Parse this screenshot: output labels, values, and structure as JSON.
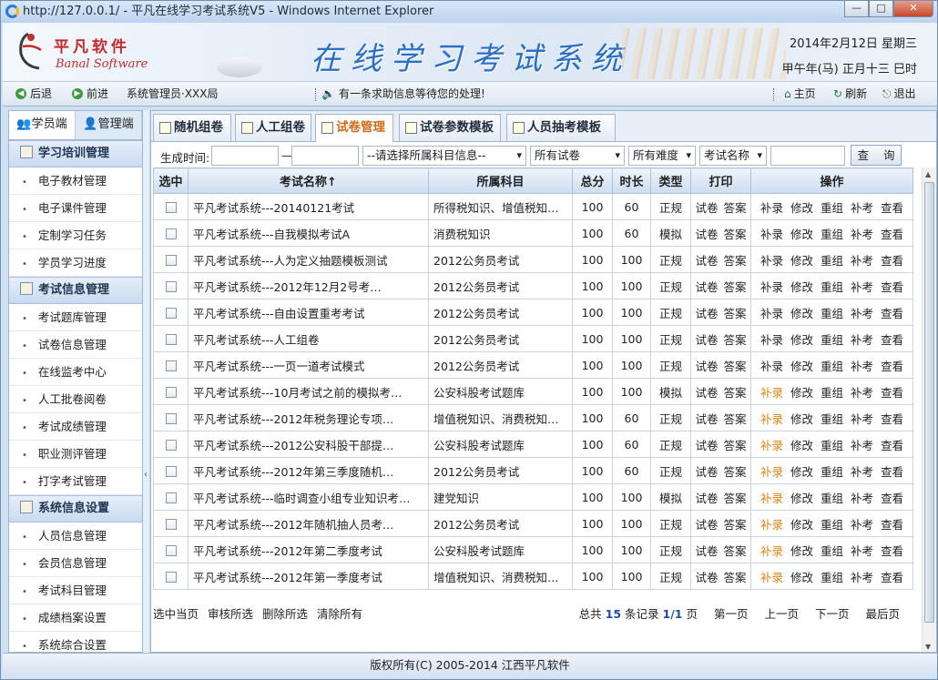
{
  "window": {
    "title": "http://127.0.0.1/ - 平凡在线学习考试系统V5 - Windows Internet Explorer",
    "controls": {
      "minimize": "—",
      "maximize": "□",
      "close": "✕"
    }
  },
  "header": {
    "logo_cn": "平凡软件",
    "logo_en": "Banal Software",
    "system_title": "在线学习考试系统",
    "date": "2014年2月12日 星期三",
    "lunar_date": "甲午年(马) 正月十三 巳时"
  },
  "navbar": {
    "back": "后退",
    "forward": "前进",
    "user": "系统管理员·XXX局",
    "notice": "有一条求助信息等待您的处理!",
    "home": "主页",
    "refresh": "刷新",
    "logout": "退出"
  },
  "sidebar": {
    "tabs": [
      "学员端",
      "管理端"
    ],
    "groups": [
      {
        "title": "学习培训管理",
        "items": [
          "电子教材管理",
          "电子课件管理",
          "定制学习任务",
          "学员学习进度"
        ]
      },
      {
        "title": "考试信息管理",
        "items": [
          "考试题库管理",
          "试卷信息管理",
          "在线监考中心",
          "人工批卷阅卷",
          "考试成绩管理",
          "职业测评管理",
          "打字考试管理"
        ]
      },
      {
        "title": "系统信息设置",
        "items": [
          "人员信息管理",
          "会员信息管理",
          "考试科目管理",
          "成绩档案设置",
          "系统综合设置"
        ]
      }
    ]
  },
  "tabs": [
    "随机组卷",
    "人工组卷",
    "试卷管理",
    "试卷参数模板",
    "人员抽考模板"
  ],
  "filters": {
    "date_label": "生成时间:",
    "date_sep": "—",
    "subject": "--请选择所属科目信息--",
    "paper": "所有试卷",
    "difficulty": "所有难度",
    "field": "考试名称",
    "query": "查 询"
  },
  "table": {
    "headers": [
      "选中",
      "考试名称↑",
      "所属科目",
      "总分",
      "时长",
      "类型",
      "打印",
      "操作"
    ],
    "print_labels": [
      "试卷",
      "答案"
    ],
    "op_labels": [
      "补录",
      "修改",
      "重组",
      "补考",
      "查看"
    ],
    "rows": [
      {
        "name": "平凡考试系统---20140121考试",
        "subject": "所得税知识、增值税知…",
        "score": "100",
        "duration": "60",
        "type": "正规",
        "hl": false
      },
      {
        "name": "平凡考试系统---自我模拟考试A",
        "subject": "消费税知识",
        "score": "100",
        "duration": "60",
        "type": "模拟",
        "hl": false
      },
      {
        "name": "平凡考试系统---人为定义抽题模板测试",
        "subject": "2012公务员考试",
        "score": "100",
        "duration": "100",
        "type": "正规",
        "hl": false
      },
      {
        "name": "平凡考试系统---2012年12月2号考…",
        "subject": "2012公务员考试",
        "score": "100",
        "duration": "100",
        "type": "正规",
        "hl": false
      },
      {
        "name": "平凡考试系统---自由设置重考考试",
        "subject": "2012公务员考试",
        "score": "100",
        "duration": "100",
        "type": "正规",
        "hl": false
      },
      {
        "name": "平凡考试系统---人工组卷",
        "subject": "2012公务员考试",
        "score": "100",
        "duration": "100",
        "type": "正规",
        "hl": false
      },
      {
        "name": "平凡考试系统---一页一道考试模式",
        "subject": "2012公务员考试",
        "score": "100",
        "duration": "100",
        "type": "正规",
        "hl": false
      },
      {
        "name": "平凡考试系统---10月考试之前的模拟考…",
        "subject": "公安科股考试题库",
        "score": "100",
        "duration": "100",
        "type": "模拟",
        "hl": true
      },
      {
        "name": "平凡考试系统---2012年税务理论专项…",
        "subject": "增值税知识、消费税知…",
        "score": "100",
        "duration": "60",
        "type": "正规",
        "hl": true
      },
      {
        "name": "平凡考试系统---2012公安科股干部提…",
        "subject": "公安科股考试题库",
        "score": "100",
        "duration": "60",
        "type": "正规",
        "hl": true
      },
      {
        "name": "平凡考试系统---2012年第三季度随机…",
        "subject": "2012公务员考试",
        "score": "100",
        "duration": "60",
        "type": "正规",
        "hl": true
      },
      {
        "name": "平凡考试系统---临时调查小组专业知识考…",
        "subject": "建党知识",
        "score": "100",
        "duration": "100",
        "type": "模拟",
        "hl": true
      },
      {
        "name": "平凡考试系统---2012年随机抽人员考…",
        "subject": "2012公务员考试",
        "score": "100",
        "duration": "100",
        "type": "正规",
        "hl": true
      },
      {
        "name": "平凡考试系统---2012年第二季度考试",
        "subject": "公安科股考试题库",
        "score": "100",
        "duration": "100",
        "type": "正规",
        "hl": true
      },
      {
        "name": "平凡考试系统---2012年第一季度考试",
        "subject": "增值税知识、消费税知…",
        "score": "100",
        "duration": "100",
        "type": "正规",
        "hl": true
      }
    ]
  },
  "actions": {
    "select_page": "选中当页",
    "approve": "审核所选",
    "delete": "删除所选",
    "clear": "清除所有"
  },
  "pager": {
    "total_prefix": "总共",
    "total": "15",
    "total_suffix": "条记录",
    "page": "1/1",
    "page_suffix": "页",
    "first": "第一页",
    "prev": "上一页",
    "next": "下一页",
    "last": "最后页"
  },
  "copyright": "版权所有(C) 2005-2014 江西平凡软件",
  "colors": {
    "accent": "#2b6fc4",
    "highlight": "#e08210",
    "logo": "#c42b2b"
  }
}
